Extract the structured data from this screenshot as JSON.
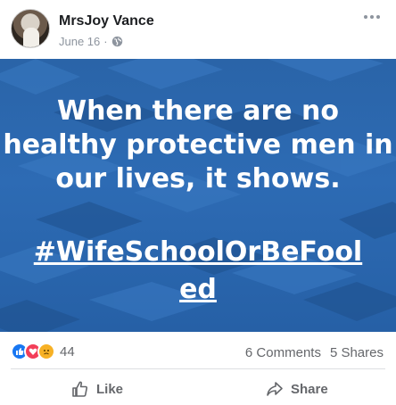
{
  "post": {
    "author": "MrsJoy Vance",
    "date": "June 16",
    "separator": "·",
    "image_text": "When there are no healthy protective men in our lives, it shows.",
    "hashtag": "#WifeSchoolOrBeFooled"
  },
  "stats": {
    "reaction_count": "44",
    "comments": "6 Comments",
    "shares": "5 Shares",
    "reactions": [
      "like-icon",
      "love-icon",
      "sad-icon"
    ]
  },
  "actions": {
    "like_label": "Like",
    "share_label": "Share"
  },
  "colors": {
    "image_bg": "#2d6bb4",
    "like": "#1877f2",
    "love": "#f33e58",
    "sad": "#f7b125"
  }
}
